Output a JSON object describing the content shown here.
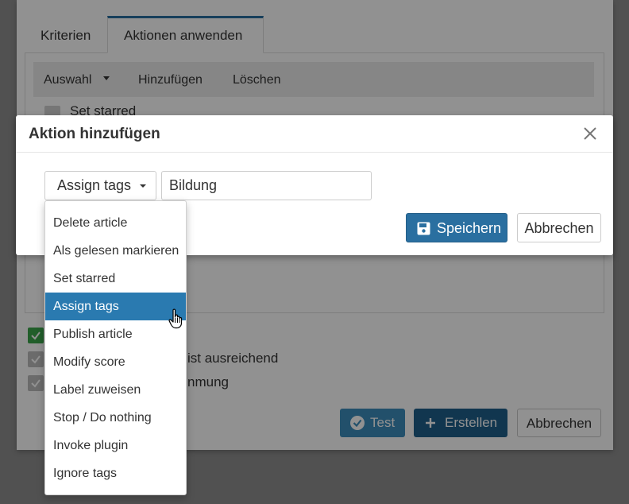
{
  "background": {
    "tabs": [
      "Kriterien",
      "Aktionen anwenden"
    ],
    "toolbar": {
      "select": "Auswahl",
      "add": "Hinzufügen",
      "delete": "Löschen"
    },
    "row_text": "Set starred",
    "option_fragment_1": "ist ausreichend",
    "option_fragment_2": "nmung",
    "buttons": {
      "test": "Test",
      "create": "Erstellen",
      "cancel": "Abbrechen"
    }
  },
  "modal": {
    "title": "Aktion hinzufügen",
    "close_icon": "close-icon",
    "action_select_value": "Assign tags",
    "tag_input_value": "Bildung",
    "save_label": "Speichern",
    "cancel_label": "Abbrechen"
  },
  "dropdown": {
    "items": [
      {
        "label": "Delete article"
      },
      {
        "label": "Als gelesen markieren"
      },
      {
        "label": "Set starred"
      },
      {
        "label": "Assign tags",
        "active": true
      },
      {
        "label": "Publish article"
      },
      {
        "label": "Modify score"
      },
      {
        "label": "Label zuweisen"
      },
      {
        "label": "Stop / Do nothing"
      },
      {
        "label": "Invoke plugin"
      },
      {
        "label": "Ignore tags"
      }
    ]
  },
  "colors": {
    "primary": "#2a6fa0",
    "active_item": "#2a7ab0",
    "success": "#3aa64a"
  }
}
